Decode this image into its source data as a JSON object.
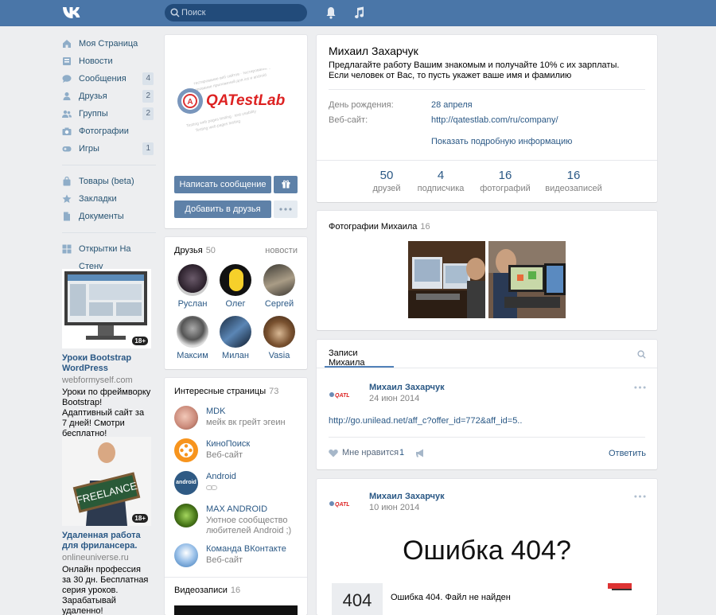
{
  "search": {
    "placeholder": "Поиск"
  },
  "nav": {
    "items": [
      {
        "label": "Моя Страница",
        "count": ""
      },
      {
        "label": "Новости",
        "count": ""
      },
      {
        "label": "Сообщения",
        "count": "4"
      },
      {
        "label": "Друзья",
        "count": "2"
      },
      {
        "label": "Группы",
        "count": "2"
      },
      {
        "label": "Фотографии",
        "count": ""
      },
      {
        "label": "Игры",
        "count": "1"
      },
      {
        "label": "Товары (beta)",
        "count": ""
      },
      {
        "label": "Закладки",
        "count": ""
      },
      {
        "label": "Документы",
        "count": ""
      },
      {
        "label": "Открытки На Стену",
        "count": ""
      }
    ]
  },
  "ads": [
    {
      "title": "Уроки Bootstrap WordPress",
      "domain": "webformyself.com",
      "text": "Уроки по фреймворку Bootstrap! Адаптивный сайт за 7 дней! Смотри бесплатно!",
      "age": "18+"
    },
    {
      "title": "Удаленная работа для фрилансера.",
      "domain": "onlineuniverse.ru",
      "text": "Онлайн профессия за 30 дн. Бесплатная серия уроков. Зарабатывай удаленно!",
      "age": "18+",
      "sign": "FREELANCE"
    }
  ],
  "profile": {
    "logo_text": "QATestLab",
    "write_button": "Написать сообщение",
    "add_button": "Добавить в друзья",
    "name": "Михаил Захарчук",
    "status": "Предлагайте работу Вашим знакомым и получайте 10% с их зарплаты. Если человек от Вас, то пусть укажет ваше имя и фамилию",
    "birthday_label": "День рождения:",
    "birthday_value": "28 апреля",
    "website_label": "Веб-сайт:",
    "website_value": "http://qatestlab.com/ru/company/",
    "more_info": "Показать подробную информацию",
    "counters": [
      {
        "value": "50",
        "label": "друзей"
      },
      {
        "value": "4",
        "label": "подписчика"
      },
      {
        "value": "16",
        "label": "фотографий"
      },
      {
        "value": "16",
        "label": "видеозаписей"
      }
    ]
  },
  "friends": {
    "title": "Друзья",
    "count": "50",
    "news": "новости",
    "items": [
      {
        "name": "Руслан"
      },
      {
        "name": "Олег"
      },
      {
        "name": "Сергей"
      },
      {
        "name": "Максим"
      },
      {
        "name": "Милан"
      },
      {
        "name": "Vasia"
      }
    ]
  },
  "pages": {
    "title": "Интересные страницы",
    "count": "73",
    "items": [
      {
        "name": "MDK",
        "desc": "мейк вк грейт эгеин"
      },
      {
        "name": "КиноПоиск",
        "desc": "Веб-сайт"
      },
      {
        "name": "Android",
        "desc": "",
        "avatar_text": "android"
      },
      {
        "name": "MAX ANDROID",
        "desc": "Уютное сообщество любителей Android ;)"
      },
      {
        "name": "Команда ВКонтакте",
        "desc": "Веб-сайт"
      }
    ]
  },
  "videos": {
    "title": "Видеозаписи",
    "count": "16"
  },
  "photos": {
    "title": "Фотографии Михаила",
    "count": "16"
  },
  "wall": {
    "tab": "Записи Михаила",
    "posts": [
      {
        "author": "Михаил Захарчук",
        "date": "24 июн 2014",
        "text": "http://go.unilead.net/aff_c?offer_id=772&aff_id=5..",
        "like_label": "Мне нравится",
        "likes": "1",
        "reply": "Ответить"
      },
      {
        "author": "Михаил Захарчук",
        "date": "10 июн 2014",
        "banner": "Ошибка 404?",
        "box_num": "404",
        "box_text": "Ошибка 404. Файл не найден"
      }
    ]
  },
  "colors": {
    "header": "#4a76a8",
    "link": "#2a5885",
    "button": "#5e81a8"
  }
}
